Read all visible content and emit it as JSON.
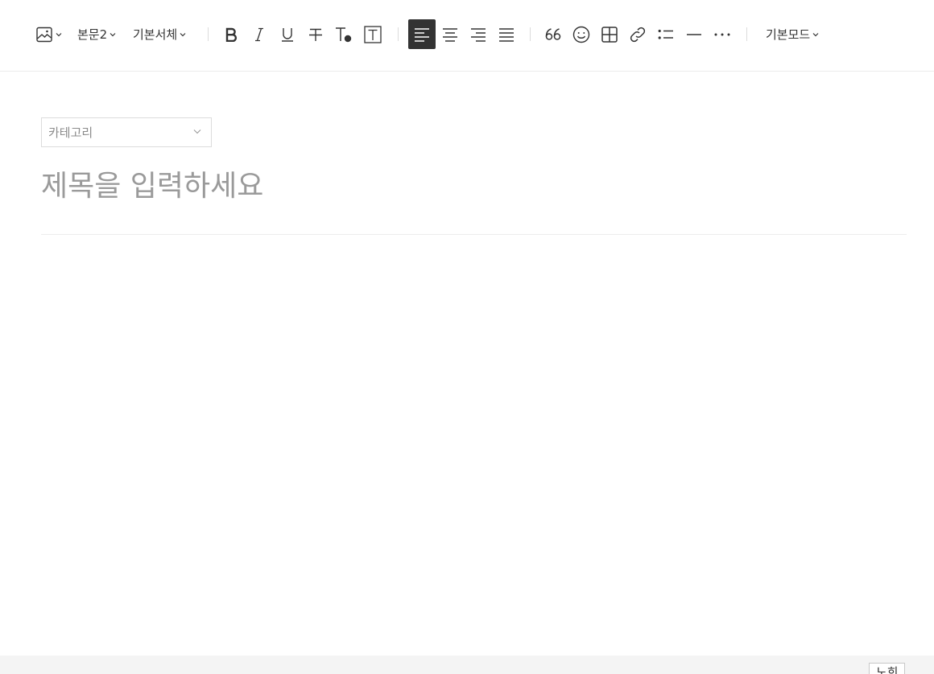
{
  "toolbar": {
    "text_style": "본문2",
    "font_family": "기본서체",
    "mode": "기본모드",
    "icons": {
      "image": "image-icon",
      "bold": "bold-icon",
      "italic": "italic-icon",
      "underline": "underline-icon",
      "strikethrough": "strikethrough-icon",
      "text_color": "text-color-icon",
      "text_background": "text-background-icon",
      "align_left": "align-left-icon",
      "align_center": "align-center-icon",
      "align_right": "align-right-icon",
      "align_justify": "align-justify-icon",
      "quote": "quote-icon",
      "emoticon": "emoticon-icon",
      "table": "table-icon",
      "link": "link-icon",
      "list": "list-icon",
      "divider": "horizontal-line-icon",
      "more": "more-icon"
    },
    "active_color": "#333333"
  },
  "editor": {
    "category_placeholder": "카테고리",
    "title_placeholder": "제목을 입력하세요"
  },
  "footer": {
    "button_label": "노희"
  }
}
